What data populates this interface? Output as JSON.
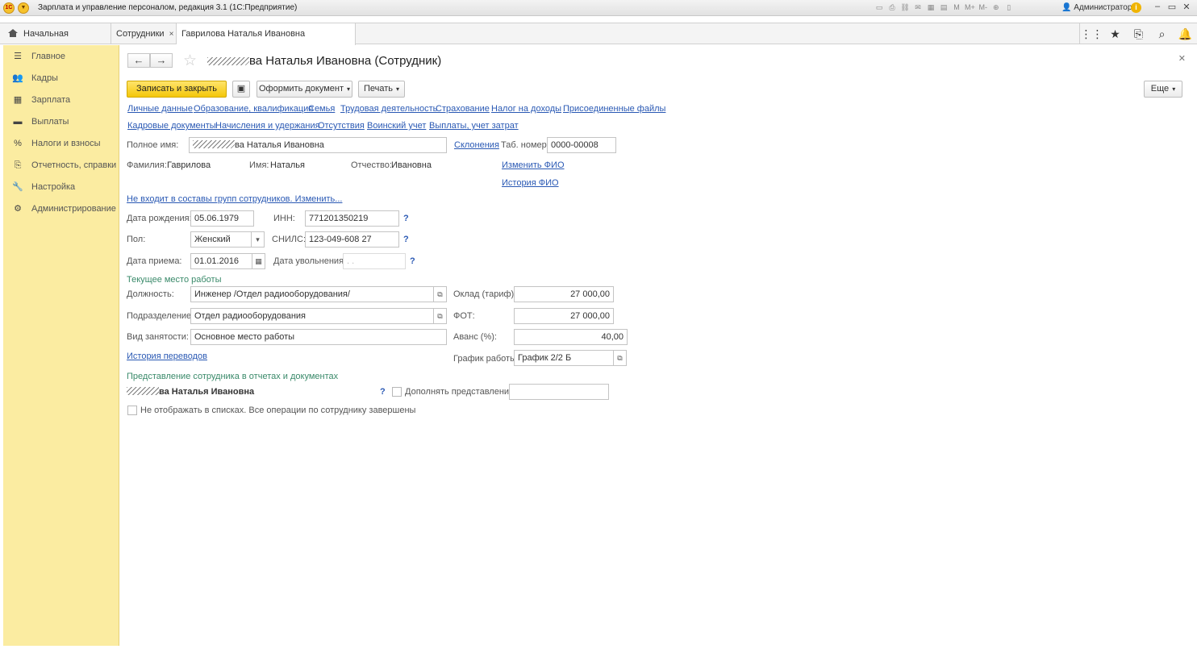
{
  "window": {
    "title": "Зарплата и управление персоналом, редакция 3.1  (1С:Предприятие)",
    "user": "Администратор",
    "toolbar_icons": [
      "save-icon",
      "print-icon",
      "link-icon",
      "mail-icon",
      "calendar-icon",
      "calc-icon",
      "memory-icon",
      "memory-plus-icon",
      "memory-minus-icon",
      "zoom-icon",
      "panel-icon"
    ]
  },
  "tabs": {
    "home": "Начальная страница",
    "employees": "Сотрудники",
    "card": "Гаврилова Наталья Ивановна (Сотрудник)",
    "close": "×"
  },
  "sidebar": {
    "items": [
      {
        "label": "Главное",
        "icon": "menu-icon"
      },
      {
        "label": "Кадры",
        "icon": "people-icon"
      },
      {
        "label": "Зарплата",
        "icon": "calculator-icon"
      },
      {
        "label": "Выплаты",
        "icon": "wallet-icon"
      },
      {
        "label": "Налоги и взносы",
        "icon": "percent-icon"
      },
      {
        "label": "Отчетность, справки",
        "icon": "report-icon"
      },
      {
        "label": "Настройка",
        "icon": "wrench-icon"
      },
      {
        "label": "Администрирование",
        "icon": "gear-icon"
      }
    ]
  },
  "form": {
    "title_suffix": "ва Наталья Ивановна (Сотрудник)",
    "buttons": {
      "save_close": "Записать и закрыть",
      "make_document": "Оформить документ",
      "print": "Печать",
      "more": "Еще"
    },
    "links_row1": [
      "Личные данные",
      "Образование, квалификация",
      "Семья",
      "Трудовая деятельность",
      "Страхование",
      "Налог на доходы",
      "Присоединенные файлы"
    ],
    "links_row2": [
      "Кадровые документы",
      "Начисления и удержания",
      "Отсутствия",
      "Воинский учет",
      "Выплаты, учет затрат"
    ],
    "full_name_label": "Полное имя:",
    "full_name_suffix": "ва Наталья Ивановна",
    "declensions": "Склонения",
    "tab_number_label": "Таб. номер:",
    "tab_number": "0000-00008",
    "surname_label": "Фамилия:",
    "surname": "Гаврилова",
    "name_label": "Имя:",
    "name": "Наталья",
    "patronymic_label": "Отчество:",
    "patronymic": "Ивановна",
    "change_fio": "Изменить ФИО",
    "fio_history": "История ФИО",
    "groups_link": "Не входит в составы групп сотрудников. Изменить...",
    "birth_label": "Дата рождения:",
    "birth": "05.06.1979",
    "inn_label": "ИНН:",
    "inn": "771201350219",
    "gender_label": "Пол:",
    "gender": "Женский",
    "snils_label": "СНИЛС:",
    "snils": "123-049-608 27",
    "hire_label": "Дата приема:",
    "hire": "01.01.2016",
    "dismiss_label": "Дата увольнения:",
    "dismiss": " .  .",
    "help": "?",
    "workplace_section": "Текущее место работы",
    "position_label": "Должность:",
    "position": "Инженер /Отдел радиооборудования/",
    "department_label": "Подразделение:",
    "department": "Отдел радиооборудования",
    "employment_label": "Вид занятости:",
    "employment": "Основное место работы",
    "salary_label": "Оклад (тариф):",
    "salary": "27 000,00",
    "fot_label": "ФОТ:",
    "fot": "27 000,00",
    "advance_label": "Аванс (%):",
    "advance": "40,00",
    "schedule_label": "График работы:",
    "schedule": "График 2/2 Б",
    "transfers_link": "История переводов",
    "representation_section": "Представление сотрудника в отчетах и документах",
    "representation_suffix": "ва Наталья Ивановна",
    "supplement_label": "Дополнять представление",
    "hide_label": "Не отображать в списках. Все операции по сотруднику завершены"
  }
}
